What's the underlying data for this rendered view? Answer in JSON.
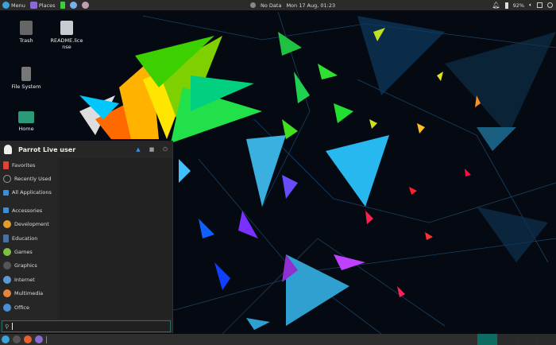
{
  "topbar": {
    "menu_label": "Menu",
    "places_label": "Places",
    "network_status": "No Data",
    "datetime": "Mon 17 Aug, 01:23",
    "battery": "92%"
  },
  "desktop": {
    "icons": [
      {
        "label": "Trash"
      },
      {
        "label": "README.license"
      },
      {
        "label": "File System"
      },
      {
        "label": "Home"
      }
    ]
  },
  "menu": {
    "user": "Parrot Live user",
    "sections": [
      {
        "label": "Favorites",
        "color": "#d9453a"
      },
      {
        "label": "Recently Used",
        "color": "#777"
      },
      {
        "label": "All Applications",
        "color": "#3b8fd9"
      }
    ],
    "categories": [
      {
        "label": "Accessories",
        "color": "#3b8fd9"
      },
      {
        "label": "Development",
        "color": "#e59a2a"
      },
      {
        "label": "Education",
        "color": "#4a6fa5"
      },
      {
        "label": "Games",
        "color": "#7cc242"
      },
      {
        "label": "Graphics",
        "color": "#555"
      },
      {
        "label": "Internet",
        "color": "#5a9bd5"
      },
      {
        "label": "Multimedia",
        "color": "#e8843a"
      },
      {
        "label": "Office",
        "color": "#4a8fd4"
      }
    ],
    "search_value": ""
  },
  "colors": {
    "accent": "#2a6e66",
    "panel": "#2b2b2b"
  }
}
